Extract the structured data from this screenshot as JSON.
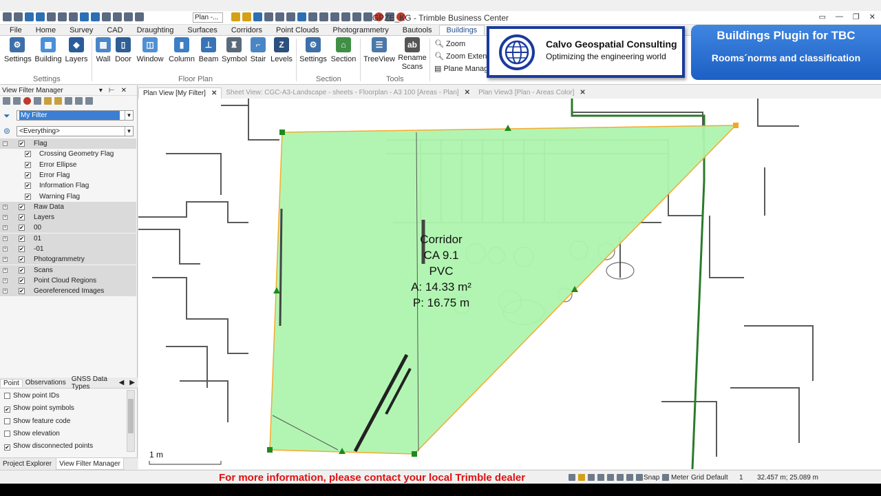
{
  "window": {
    "title": "GPZE_KG - Trimble Business Center",
    "view_combo": "Plan -...",
    "controls": [
      "▭",
      "—",
      "❐",
      "✕"
    ]
  },
  "ribbon_tabs": [
    "File",
    "Home",
    "Survey",
    "CAD",
    "Draughting",
    "Surfaces",
    "Corridors",
    "Point Clouds",
    "Photogrammetry",
    "Bautools",
    "Buildings"
  ],
  "ribbon": {
    "settings_group": {
      "label": "Settings",
      "buttons": [
        "Settings",
        "Building",
        "Layers"
      ]
    },
    "floorplan_group": {
      "label": "Floor Plan",
      "buttons": [
        "Wall",
        "Door",
        "Window",
        "Column",
        "Beam",
        "Symbol",
        "Stair",
        "Levels"
      ]
    },
    "section_group": {
      "label": "Section",
      "buttons": [
        "Settings",
        "Section"
      ]
    },
    "tools_group": {
      "label": "Tools",
      "buttons": [
        "TreeView",
        "Rename Scans"
      ]
    },
    "view_small": [
      "Zoom",
      "Zoom Extents",
      "Plane Manager"
    ]
  },
  "overlay": {
    "company_name": "Calvo Geospatial Consulting",
    "company_tagline": "Optimizing the engineering world",
    "plugin_title": "Buildings Plugin for TBC",
    "plugin_subtitle": "Rooms´norms and classification"
  },
  "left_panel": {
    "title": "View Filter Manager",
    "filter_value": "My Filter",
    "scope_value": "<Everything>",
    "tree": [
      {
        "label": "Flag",
        "level": 0,
        "checked": true,
        "group": true,
        "expanded": true
      },
      {
        "label": "Crossing Geometry Flag",
        "level": 1,
        "checked": true
      },
      {
        "label": "Error Ellipse",
        "level": 1,
        "checked": true
      },
      {
        "label": "Error Flag",
        "level": 1,
        "checked": true
      },
      {
        "label": "Information Flag",
        "level": 1,
        "checked": true
      },
      {
        "label": "Warning Flag",
        "level": 1,
        "checked": true
      },
      {
        "label": "Raw Data",
        "level": 0,
        "checked": true,
        "group": true
      },
      {
        "label": "Layers",
        "level": 0,
        "checked": true,
        "group": true
      },
      {
        "label": "00",
        "level": 0,
        "checked": true,
        "group": true
      },
      {
        "label": "01",
        "level": 0,
        "checked": true,
        "group": true
      },
      {
        "label": "-01",
        "level": 0,
        "checked": true,
        "group": true
      },
      {
        "label": "Photogrammetry",
        "level": 0,
        "checked": true,
        "group": true
      },
      {
        "label": "Scans",
        "level": 0,
        "checked": true,
        "group": true
      },
      {
        "label": "Point Cloud Regions",
        "level": 0,
        "checked": true,
        "group": true
      },
      {
        "label": "Georeferenced Images",
        "level": 0,
        "checked": true,
        "group": true
      }
    ],
    "bottom_tabs": [
      "Point",
      "Observations",
      "GNSS Data Types"
    ],
    "options": [
      {
        "label": "Show point IDs",
        "checked": false
      },
      {
        "label": "Show point symbols",
        "checked": true
      },
      {
        "label": "Show feature code",
        "checked": false
      },
      {
        "label": "Show elevation",
        "checked": false
      },
      {
        "label": "Show disconnected points",
        "checked": true
      }
    ],
    "footer_tabs": [
      "Project Explorer",
      "View Filter Manager"
    ]
  },
  "doc_tabs": [
    {
      "label": "Plan View [My Filter]",
      "active": true
    },
    {
      "label": "Sheet View: CGC-A3-Landscape - sheets - Floorplan - A3 100 [Areas - Plan]",
      "active": false
    },
    {
      "label": "Plan View3 [Plan - Areas Color]",
      "active": false
    }
  ],
  "room": {
    "name": "Corridor",
    "code": "CA 9.1",
    "material": "PVC",
    "area": "A: 14.33 m²",
    "perimeter": "P: 16.75 m",
    "fill_color": "#aef5ae",
    "edge_color": "#f5a623"
  },
  "scale_label": "1 m",
  "status": {
    "dealer_message": "For more information, please contact your local Trimble dealer",
    "snap": "Snap",
    "unit": "Meter",
    "grid": "Grid",
    "mode": "Default",
    "count": "1",
    "coords": "32.457 m; 25.089 m"
  }
}
